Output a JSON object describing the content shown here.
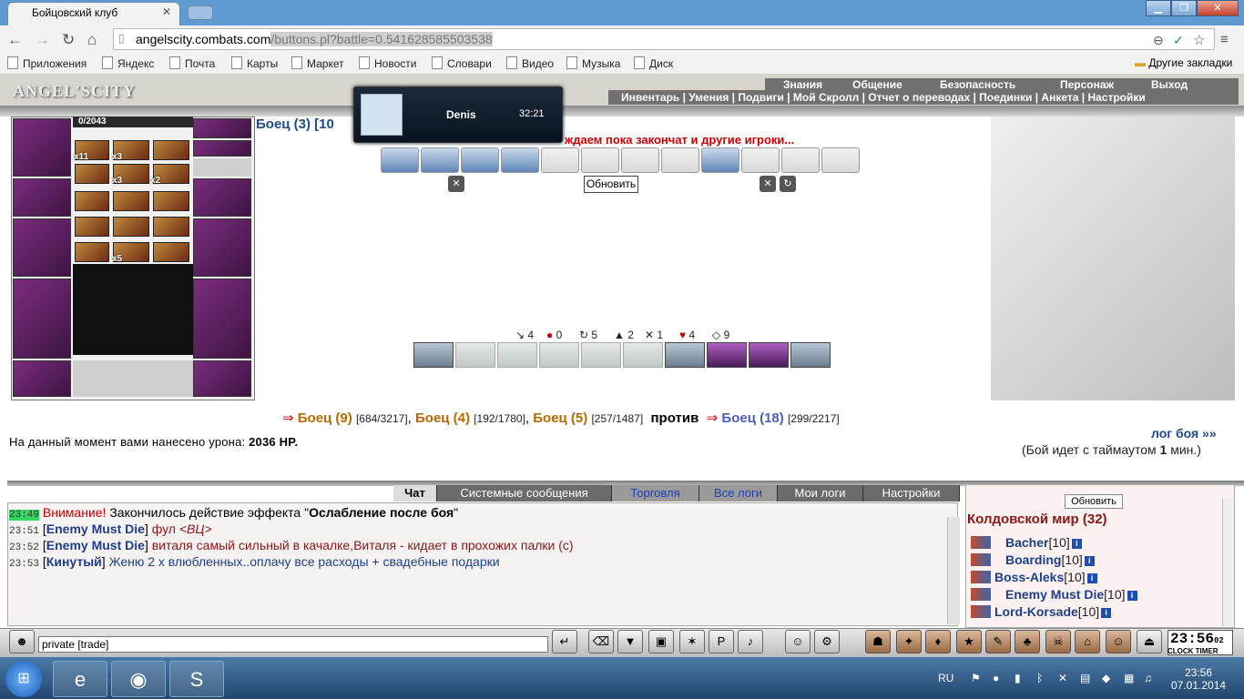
{
  "browser": {
    "tab_title": "Бойцовский клуб",
    "url_host": "angelscity.combats.com",
    "url_path": "/buttons.pl?battle=0.541628585503538",
    "bookmarks": [
      "Приложения",
      "Яндекс",
      "Почта",
      "Карты",
      "Маркет",
      "Новости",
      "Словари",
      "Видео",
      "Музыка",
      "Диск"
    ],
    "other_bookmarks": "Другие закладки"
  },
  "game": {
    "logo": "ANGEL'SCITY",
    "top_menu": [
      "Знания",
      "Общение",
      "Безопасность",
      "Персонаж",
      "Выход"
    ],
    "sub_menu": "Инвентарь | Умения | Подвиги | Мой Скролл | Отчет о переводах | Поединки | Анкета | Настройки",
    "xp": "0/2043",
    "fighter_link": "Боец (3) [10",
    "popup": {
      "name": "Denis",
      "time": "32:21"
    },
    "wait_msg": "ждаем пока закончат и другие игроки...",
    "refresh": "Обновить",
    "quantities": {
      "q1": "x11",
      "q2": "x3",
      "q3": "x3",
      "q4": "x2",
      "q5": "x5"
    },
    "stats": [
      "4",
      "0",
      "5",
      "2",
      "1",
      "4",
      "9"
    ],
    "team1": [
      {
        "name": "Боец (9)",
        "hp": "[684/3217]"
      },
      {
        "name": "Боец (4)",
        "hp": "[192/1780]"
      },
      {
        "name": "Боец (5)",
        "hp": "[257/1487]"
      }
    ],
    "vs": "против",
    "team2": {
      "name": "Боец (18)",
      "hp": "[299/2217]"
    },
    "damage_label": "На данный момент вами нанесено урона:",
    "damage_value": "2036 HP.",
    "log_link": "лог боя »»",
    "timeout_pre": "(Бой идет с таймаутом",
    "timeout_num": "1",
    "timeout_post": "мин.)"
  },
  "chat": {
    "tabs": [
      "Чат",
      "Системные сообщения",
      "Торговля",
      "Все логи",
      "Мои логи",
      "Настройки"
    ],
    "lines": [
      {
        "time": "23:49",
        "prefix": "Внимание!",
        "text": " Закончилось действие эффекта \"",
        "bold": "Ослабление после боя",
        "end": "\""
      },
      {
        "time": "23:51",
        "nick": "Enemy Must Die",
        "text": "фул ",
        "italic": "<ВЦ>"
      },
      {
        "time": "23:52",
        "nick": "Enemy Must Die",
        "text": "виталя самый сильный в качалке,Виталя - кидает в прохожих палки (с)"
      },
      {
        "time": "23:53",
        "nick": "Кинутый",
        "text": "Женю 2 х влюбленных..оплачу все расходы + свадебные подарки"
      }
    ],
    "input_value": "private [trade]"
  },
  "online": {
    "refresh": "Обновить",
    "title": "Колдовской мир (32)",
    "users": [
      {
        "name": "Bacher",
        "level": "[10]"
      },
      {
        "name": "Boarding",
        "level": "[10]"
      },
      {
        "name": "Boss-Aleks",
        "level": "[10]"
      },
      {
        "name": "Enemy Must Die",
        "level": "[10]"
      },
      {
        "name": "Lord-Korsade",
        "level": "[10]"
      }
    ]
  },
  "clock": {
    "time": "23:56",
    "sec": "02",
    "label": "CLOCK TIMER"
  },
  "taskbar": {
    "lang": "RU",
    "time": "23:56",
    "date": "07.01.2014"
  }
}
